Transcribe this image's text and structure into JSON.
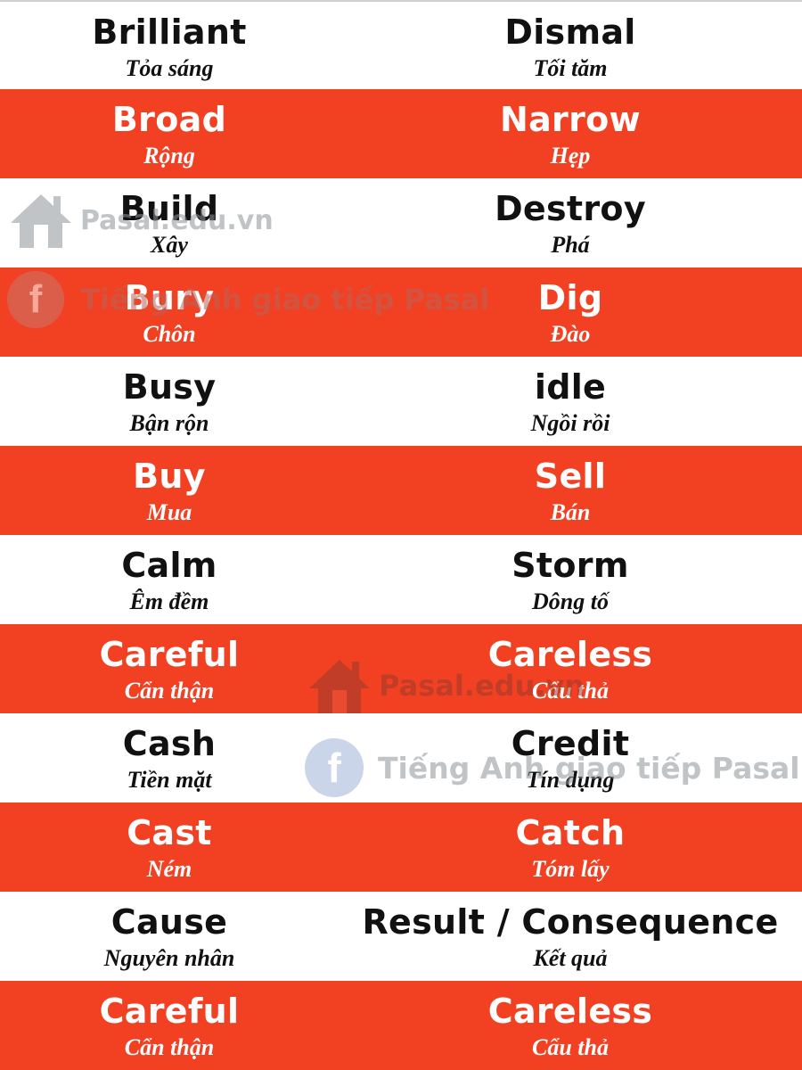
{
  "rows": [
    {
      "left_word": "Brilliant",
      "left_meaning": "Tỏa sáng",
      "right_word": "Dismal",
      "right_meaning": "Tối tăm",
      "style": "white"
    },
    {
      "left_word": "Broad",
      "left_meaning": "Rộng",
      "right_word": "Narrow",
      "right_meaning": "Hẹp",
      "style": "red"
    },
    {
      "left_word": "Build",
      "left_meaning": "Xây",
      "right_word": "Destroy",
      "right_meaning": "Phá",
      "style": "white"
    },
    {
      "left_word": "Bury",
      "left_meaning": "Chôn",
      "right_word": "Dig",
      "right_meaning": "Đào",
      "style": "red"
    },
    {
      "left_word": "Busy",
      "left_meaning": "Bận rộn",
      "right_word": "idle",
      "right_meaning": "Ngồi rồi",
      "style": "white"
    },
    {
      "left_word": "Buy",
      "left_meaning": "Mua",
      "right_word": "Sell",
      "right_meaning": "Bán",
      "style": "red"
    },
    {
      "left_word": "Calm",
      "left_meaning": "Êm đềm",
      "right_word": "Storm",
      "right_meaning": "Dông tố",
      "style": "white"
    },
    {
      "left_word": "Careful",
      "left_meaning": "Cẩn thận",
      "right_word": "Careless",
      "right_meaning": "Cẩu thả",
      "style": "red"
    },
    {
      "left_word": "Cash",
      "left_meaning": "Tiền mặt",
      "right_word": "Credit",
      "right_meaning": "Tín dụng",
      "style": "white"
    },
    {
      "left_word": "Cast",
      "left_meaning": "Ném",
      "right_word": "Catch",
      "right_meaning": "Tóm lấy",
      "style": "red"
    },
    {
      "left_word": "Cause",
      "left_meaning": "Nguyên nhân",
      "right_word": "Result  /  Consequence",
      "right_meaning": "Kết quả",
      "style": "white"
    },
    {
      "left_word": "Careful",
      "left_meaning": "Cẩn thận",
      "right_word": "Careless",
      "right_meaning": "Cẩu thả",
      "style": "red"
    }
  ],
  "watermarks": {
    "site": "Pasal.edu.vn",
    "facebook": "Tiếng Anh giao tiếp Pasal",
    "facebook_icon_letter": "f",
    "icons": [
      "house-icon",
      "facebook-icon"
    ]
  },
  "colors": {
    "red_row": "#f24022",
    "white_row": "#ffffff",
    "dark_text": "#111111",
    "light_text": "#ffffff",
    "watermark_gray": "#9aa0a6",
    "watermark_blue": "#9fb3d9"
  }
}
